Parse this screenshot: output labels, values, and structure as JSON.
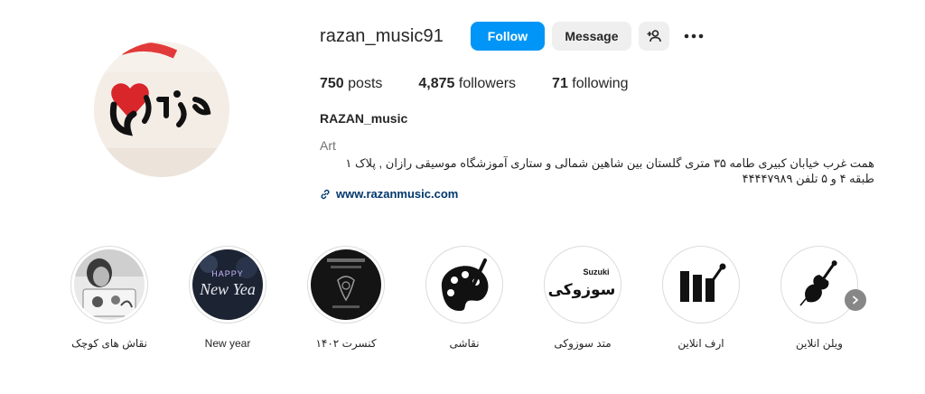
{
  "profile": {
    "username": "razan_music91",
    "full_name": "RAZAN_music",
    "category": "Art",
    "bio": "همت غرب خیابان کبیری طامه ۳۵ متری گلستان بین شاهین شمالی و ستاری آموزشگاه موسیقی رازان , پلاک ۱ طبقه ۴ و ۵ تلفن ۴۴۴۴۷۹۸۹",
    "website": "www.razanmusic.com",
    "avatar_icon": "razan-logo-icon"
  },
  "actions": {
    "follow_label": "Follow",
    "message_label": "Message",
    "suggest_icon": "add-person-icon",
    "more_icon": "more-options-icon"
  },
  "stats": {
    "posts_count": "750",
    "posts_label": "posts",
    "followers_count": "4,875",
    "followers_label": "followers",
    "following_count": "71",
    "following_label": "following"
  },
  "highlights": [
    {
      "label": "نقاش های کوچک",
      "icon": "kids-painting-photo"
    },
    {
      "label": "New year",
      "icon": "happy-new-year-image",
      "image_text": [
        "HAPPY",
        "New Yea"
      ]
    },
    {
      "label": "کنسرت ۱۴۰۲",
      "icon": "concert-poster-image"
    },
    {
      "label": "نقاشی",
      "icon": "palette-icon"
    },
    {
      "label": "متد سوزوکی",
      "icon": "suzuki-logo-icon",
      "image_text": [
        "Suzuki",
        "سوزوکی"
      ]
    },
    {
      "label": "ارف انلاین",
      "icon": "orff-xylophone-icon"
    },
    {
      "label": "ویلن انلاین",
      "icon": "violin-icon"
    }
  ],
  "highlights_next_icon": "chevron-right-icon",
  "colors": {
    "follow_button": "#0095f6",
    "secondary_button": "#efefef",
    "link": "#00376b",
    "muted_text": "#737373"
  }
}
